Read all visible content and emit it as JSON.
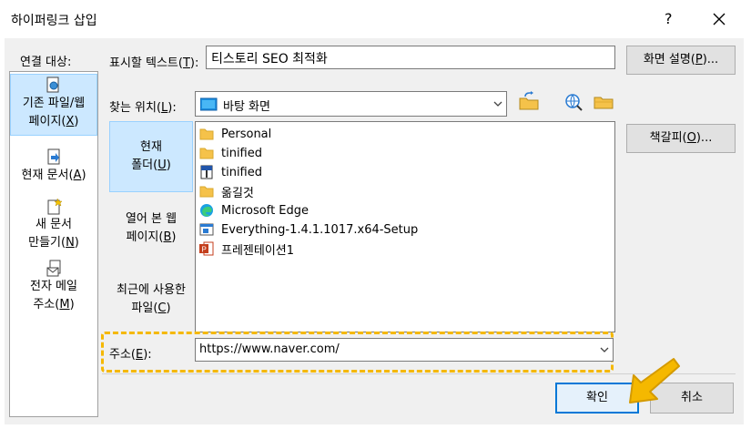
{
  "window": {
    "title": "하이퍼링크 삽입",
    "help_glyph": "?",
    "close_glyph": "✕"
  },
  "linkto": {
    "label": "연결 대상:",
    "items": [
      {
        "line1": "기존 파일/웹",
        "line2": "페이지(",
        "key": "X",
        "tail": ")",
        "selected": true
      },
      {
        "line1": "현재 문서(",
        "key": "A",
        "tail": ")",
        "selected": false
      },
      {
        "line1": "새 문서",
        "line2": "만들기(",
        "key": "N",
        "tail": ")",
        "selected": false
      },
      {
        "line1": "전자 메일",
        "line2": "주소(",
        "key": "M",
        "tail": ")",
        "selected": false
      }
    ]
  },
  "display_text": {
    "label_pre": "표시할 텍스트(",
    "label_key": "T",
    "label_post": "):",
    "value": "티스토리 SEO 최적화"
  },
  "screentip_button": {
    "pre": "화면 설명(",
    "key": "P",
    "post": ")..."
  },
  "look_in": {
    "label_pre": "찾는 위치(",
    "label_key": "L",
    "label_post": "):",
    "value": "바탕 화면"
  },
  "bookmark_button": {
    "pre": "책갈피(",
    "key": "O",
    "post": ")..."
  },
  "browse": {
    "items": [
      {
        "line1": "현재",
        "line2": "폴더(",
        "key": "U",
        "tail": ")",
        "selected": true
      },
      {
        "line1": "열어 본 웹",
        "line2": "페이지(",
        "key": "B",
        "tail": ")",
        "selected": false
      },
      {
        "line1": "최근에 사용한",
        "line2": "파일(",
        "key": "C",
        "tail": ")",
        "selected": false
      }
    ]
  },
  "files": [
    {
      "name": "Personal",
      "icon": "folder-icon"
    },
    {
      "name": "tinified",
      "icon": "folder-icon"
    },
    {
      "name": "tinified",
      "icon": "zip-icon"
    },
    {
      "name": "옮길것",
      "icon": "folder-icon"
    },
    {
      "name": "Microsoft Edge",
      "icon": "edge-icon"
    },
    {
      "name": "Everything-1.4.1.1017.x64-Setup",
      "icon": "installer-icon"
    },
    {
      "name": "프레젠테이션1",
      "icon": "powerpoint-icon"
    }
  ],
  "address": {
    "label_pre": "주소(",
    "label_key": "E",
    "label_post": "):",
    "value": "https://www.naver.com/"
  },
  "ok_button": "확인",
  "cancel_button": "취소",
  "colors": {
    "selection": "#cce8ff",
    "highlight": "#f5b800",
    "arrow": "#f5b800",
    "accent": "#0078d7"
  }
}
